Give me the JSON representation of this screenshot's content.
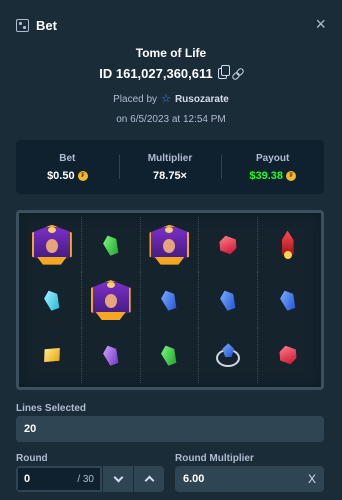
{
  "header": {
    "title": "Bet",
    "close_label": "×"
  },
  "bet": {
    "game_name": "Tome of Life",
    "id_text": "ID 161,027,360,611",
    "placed_by_label": "Placed by",
    "user": "Rusozarate",
    "date_text": "on 6/5/2023 at 12:54 PM"
  },
  "stats": {
    "bet_label": "Bet",
    "bet_value": "$0.50",
    "multiplier_label": "Multiplier",
    "multiplier_value": "78.75×",
    "payout_label": "Payout",
    "payout_value": "$39.38",
    "payout_color": "#1fff20",
    "coin_color": "#f5b82e"
  },
  "board": {
    "rows": [
      [
        "goddess",
        "green-gem",
        "goddess",
        "red-gem",
        "ship"
      ],
      [
        "cyan-gem",
        "goddess",
        "blue-gem",
        "blue-gem",
        "blue-gem"
      ],
      [
        "yellow-gem",
        "purple-gem",
        "green-gem",
        "ring",
        "red-gem"
      ]
    ]
  },
  "controls": {
    "lines_label": "Lines Selected",
    "lines_value": "20",
    "round_label": "Round",
    "round_value": "0",
    "round_total": "/ 30",
    "round_multiplier_label": "Round Multiplier",
    "round_multiplier_value": "6.00",
    "round_multiplier_suffix": "X"
  }
}
